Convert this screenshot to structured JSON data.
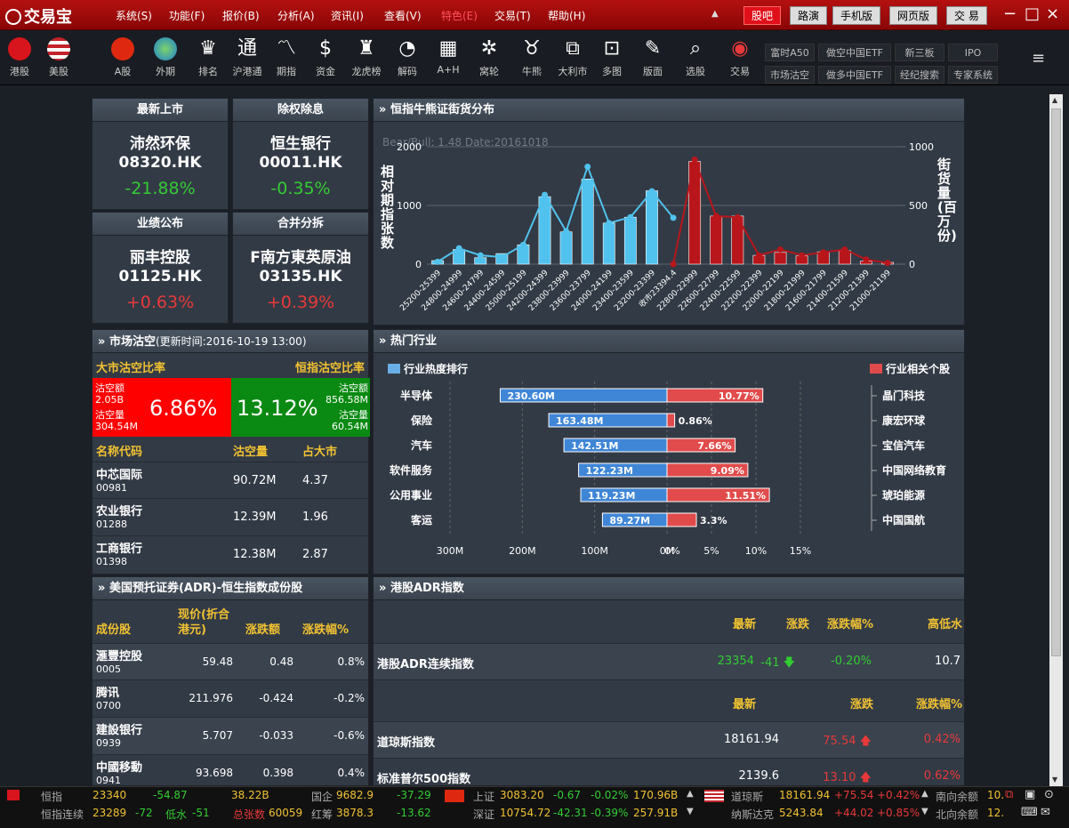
{
  "app": {
    "name": "交易宝",
    "menu": [
      "系统(S)",
      "功能(F)",
      "报价(B)",
      "分析(A)",
      "资讯(I)",
      "查看(V)",
      "特色(E)",
      "交易(T)",
      "帮助(H)"
    ],
    "top_buttons": [
      "股吧",
      "路演",
      "手机版",
      "网页版",
      "交 易"
    ]
  },
  "toolbar": {
    "items": [
      "港股",
      "美股",
      "A股",
      "外期",
      "排名",
      "沪港通",
      "期指",
      "资金",
      "龙虎榜",
      "解码",
      "A+H",
      "窝轮",
      "牛熊",
      "大利市",
      "多图",
      "版面",
      "选股",
      "交易"
    ],
    "quick_row1": [
      "富时A50",
      "做空中国ETF",
      "新三板",
      "IPO"
    ],
    "quick_row2": [
      "市场沽空",
      "做多中国ETF",
      "经纪搜索",
      "专家系统"
    ]
  },
  "cards": [
    {
      "title": "最新上市",
      "name": "沛然环保",
      "code": "08320.HK",
      "pct": "-21.88%"
    },
    {
      "title": "除权除息",
      "name": "恒生银行",
      "code": "00011.HK",
      "pct": "-0.35%"
    },
    {
      "title": "业绩公布",
      "name": "丽丰控股",
      "code": "01125.HK",
      "pct": "+0.63%"
    },
    {
      "title": "合并分拆",
      "name": "F南方東英原油",
      "code": "03135.HK",
      "pct": "+0.39%"
    }
  ],
  "bullbear": {
    "title": "恒指牛熊证街货分布",
    "subtitle": "Bear/Bull: 1.48 Date:20161018",
    "ylabel": "相对期指张数",
    "y2label": "街货量(百万份)"
  },
  "chart_data": {
    "type": "bar",
    "title": "恒指牛熊证街货分布",
    "categories": [
      "25200-25399",
      "24800-24999",
      "24600-24799",
      "24400-24599",
      "25000-25199",
      "24200-24399",
      "23800-23999",
      "23600-23799",
      "24000-24199",
      "23400-23599",
      "23200-23399",
      "收市23394.4",
      "22800-22999",
      "22600-22799",
      "22400-22599",
      "22200-22399",
      "22000-22199",
      "21800-21999",
      "21600-21799",
      "21400-21599",
      "21200-21399",
      "21000-21199"
    ],
    "series": [
      {
        "name": "bear_bars",
        "values": [
          60,
          250,
          110,
          180,
          330,
          1150,
          550,
          1450,
          700,
          800,
          1250,
          0,
          0,
          0,
          0,
          0,
          0,
          0,
          0,
          0,
          0,
          0
        ]
      },
      {
        "name": "bull_bars",
        "values": [
          0,
          0,
          0,
          0,
          0,
          0,
          0,
          0,
          0,
          0,
          0,
          0,
          1750,
          820,
          820,
          150,
          200,
          140,
          210,
          230,
          50,
          30
        ]
      },
      {
        "name": "bear_line",
        "values": [
          40,
          270,
          150,
          120,
          330,
          1180,
          560,
          1660,
          700,
          800,
          1240,
          790
        ]
      },
      {
        "name": "bull_line",
        "values": [
          0,
          0,
          0,
          0,
          0,
          0,
          0,
          0,
          0,
          0,
          0,
          0,
          1780,
          820,
          800,
          150,
          250,
          150,
          200,
          250,
          80,
          20
        ]
      }
    ],
    "ylim": [
      0,
      2000
    ],
    "y2lim": [
      0,
      1000
    ],
    "yticks": [
      "2000",
      "1000",
      "0"
    ],
    "y2ticks": [
      "1000",
      "500",
      "0"
    ],
    "colors": {
      "bear": "#51c2ee",
      "bull": "#b8161b"
    }
  },
  "short": {
    "title": "市场沽空",
    "update": "(更新时间:2016-10-19 13:00)",
    "left_head": "大市沽空比率",
    "right_head": "恒指沽空比率",
    "left": {
      "l1": "沽空额",
      "l2": "2.05B",
      "l3": "沽空量",
      "l4": "304.54M",
      "pct": "6.86%"
    },
    "right": {
      "r1": "沽空额",
      "r2": "856.58M",
      "r3": "沽空量",
      "r4": "60.54M",
      "pct": "13.12%"
    },
    "cols": [
      "名称代码",
      "沽空量",
      "占大市"
    ],
    "rows": [
      [
        "中芯国际",
        "00981",
        "90.72M",
        "4.37"
      ],
      [
        "农业银行",
        "01288",
        "12.39M",
        "1.96"
      ],
      [
        "工商银行",
        "01398",
        "12.38M",
        "2.87"
      ]
    ]
  },
  "industry": {
    "title": "热门行业",
    "left_legend": "行业热度排行",
    "right_legend": "行业相关个股",
    "rows": [
      {
        "name": "半导体",
        "heat": 230.6,
        "heat_label": "230.60M",
        "pct": 10.77,
        "pct_label": "10.77%",
        "stock": "晶门科技"
      },
      {
        "name": "保险",
        "heat": 163.48,
        "heat_label": "163.48M",
        "pct": 0.86,
        "pct_label": "0.86%",
        "stock": "康宏环球"
      },
      {
        "name": "汽车",
        "heat": 142.51,
        "heat_label": "142.51M",
        "pct": 7.66,
        "pct_label": "7.66%",
        "stock": "宝信汽车"
      },
      {
        "name": "软件服务",
        "heat": 122.23,
        "heat_label": "122.23M",
        "pct": 9.09,
        "pct_label": "9.09%",
        "stock": "中国网络教育"
      },
      {
        "name": "公用事业",
        "heat": 119.23,
        "heat_label": "119.23M",
        "pct": 11.51,
        "pct_label": "11.51%",
        "stock": "琥珀能源"
      },
      {
        "name": "客运",
        "heat": 89.27,
        "heat_label": "89.27M",
        "pct": 3.3,
        "pct_label": "3.3%",
        "stock": "中国国航"
      }
    ],
    "xticks_left": [
      "300M",
      "200M",
      "100M",
      "0M"
    ],
    "xticks_right": [
      "0%",
      "5%",
      "10%",
      "15%"
    ]
  },
  "adr": {
    "title": "美国预托证券(ADR)-恒生指数成份股",
    "cols": [
      "成份股",
      "现价(折合港元)",
      "涨跌额",
      "涨跌幅%"
    ],
    "rows": [
      [
        "滙豐控股",
        "0005",
        "59.48",
        "0.48",
        "0.8%"
      ],
      [
        "腾讯",
        "0700",
        "211.976",
        "-0.424",
        "-0.2%"
      ],
      [
        "建設银行",
        "0939",
        "5.707",
        "-0.033",
        "-0.6%"
      ],
      [
        "中國移動",
        "0941",
        "93.698",
        "0.398",
        "0.4%"
      ]
    ]
  },
  "hkadr": {
    "title": "港股ADR指数",
    "head1": [
      "最新",
      "涨跌",
      "涨跌幅%",
      "高低水"
    ],
    "row1": {
      "name": "港股ADR连续指数",
      "last": "23354",
      "chg": "-41",
      "pct": "-0.20%",
      "hl": "10.7"
    },
    "head2": [
      "最新",
      "涨跌",
      "涨跌幅%"
    ],
    "rows": [
      {
        "name": "道琼斯指数",
        "last": "18161.94",
        "chg": "75.54",
        "pct": "0.42%"
      },
      {
        "name": "标准普尔500指数",
        "last": "2139.6",
        "chg": "13.10",
        "pct": "0.62%"
      }
    ]
  },
  "status": {
    "a1": "恒指",
    "a2": "23340",
    "a3": "-54.87",
    "a4": "38.22B",
    "a5": "国企",
    "a6": "9682.9",
    "a7": "-37.29",
    "b1": "恒指连续",
    "b2": "23289",
    "b3": "-72",
    "b4": "低水",
    "b5": "-51",
    "b6": "总张数",
    "b7": "60059",
    "b8": "红筹",
    "b9": "3878.3",
    "b10": "-13.62",
    "c1": "上证",
    "c2": "3083.20",
    "c3": "-0.67",
    "c4": "-0.02%",
    "c5": "170.96B",
    "d1": "深证",
    "d2": "10754.72",
    "d3": "-42.31",
    "d4": "-0.39%",
    "d5": "257.91B",
    "e1": "道琼斯",
    "e2": "18161.94",
    "e3": "+75.54",
    "e4": "+0.42%",
    "e5": "南向余额",
    "e6": "10.",
    "f1": "纳斯达克",
    "f2": "5243.84",
    "f3": "+44.02",
    "f4": "+0.85%",
    "f5": "北向余额",
    "f6": "12."
  }
}
